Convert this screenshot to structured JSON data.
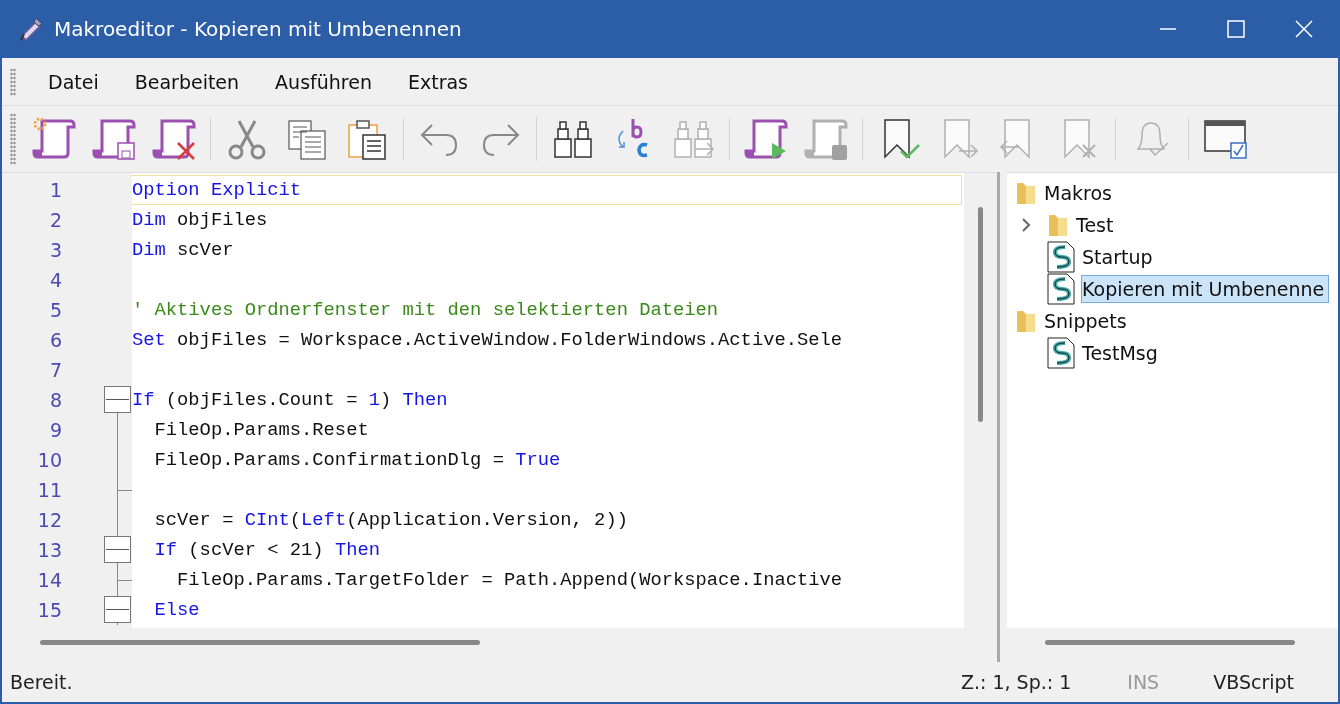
{
  "window": {
    "title": "Makroeditor - Kopieren mit Umbenennen"
  },
  "menu": [
    "Datei",
    "Bearbeiten",
    "Ausführen",
    "Extras"
  ],
  "toolbar": [
    [
      {
        "kind": "new",
        "disabled": false
      },
      {
        "kind": "save",
        "disabled": false
      },
      {
        "kind": "delete",
        "disabled": false
      }
    ],
    [
      {
        "kind": "cut",
        "disabled": false
      },
      {
        "kind": "copy",
        "disabled": false
      },
      {
        "kind": "paste",
        "disabled": false
      }
    ],
    [
      {
        "kind": "undo",
        "disabled": false
      },
      {
        "kind": "redo",
        "disabled": false
      }
    ],
    [
      {
        "kind": "find",
        "disabled": false
      },
      {
        "kind": "replace",
        "disabled": false
      },
      {
        "kind": "find-next",
        "disabled": true
      }
    ],
    [
      {
        "kind": "run",
        "disabled": false
      },
      {
        "kind": "stop",
        "disabled": true
      }
    ],
    [
      {
        "kind": "bookmark-set",
        "disabled": false
      },
      {
        "kind": "bookmark-next",
        "disabled": true
      },
      {
        "kind": "bookmark-prev",
        "disabled": true
      },
      {
        "kind": "bookmark-clear",
        "disabled": true
      }
    ],
    [
      {
        "kind": "notify",
        "disabled": true
      }
    ],
    [
      {
        "kind": "panel",
        "disabled": false
      }
    ]
  ],
  "editor": {
    "lines": [
      {
        "number": "1",
        "kind": "plain",
        "tokens": [
          {
            "kind": "keyword",
            "text": "Option Explicit"
          }
        ]
      },
      {
        "number": "2",
        "kind": "plain",
        "tokens": [
          {
            "kind": "keyword",
            "text": "Dim"
          },
          {
            "kind": "plain",
            "text": " objFiles"
          }
        ]
      },
      {
        "number": "3",
        "kind": "plain",
        "tokens": [
          {
            "kind": "keyword",
            "text": "Dim"
          },
          {
            "kind": "plain",
            "text": " scVer"
          }
        ]
      },
      {
        "number": "4",
        "kind": "plain"
      },
      {
        "number": "5",
        "kind": "plain",
        "tokens": [
          {
            "kind": "comment",
            "text": "' Aktives Ordnerfenster mit den selektierten Dateien"
          }
        ]
      },
      {
        "number": "6",
        "kind": "plain",
        "tokens": [
          {
            "kind": "keyword",
            "text": "Set"
          },
          {
            "kind": "plain",
            "text": " objFiles = Workspace.ActiveWindow.FolderWindows.Active.Sele"
          }
        ]
      },
      {
        "number": "7",
        "kind": "plain"
      },
      {
        "number": "8",
        "kind": "fold-box",
        "tokens": [
          {
            "kind": "keyword",
            "text": "If"
          },
          {
            "kind": "plain",
            "text": " (objFiles.Count = "
          },
          {
            "kind": "number",
            "text": "1"
          },
          {
            "kind": "plain",
            "text": ") "
          },
          {
            "kind": "keyword",
            "text": "Then"
          }
        ],
        "children": [
          {
            "number": "9",
            "kind": "fold-line",
            "tokens": [
              {
                "kind": "plain",
                "text": "FileOp.Params.Reset"
              }
            ]
          },
          {
            "number": "10",
            "kind": "fold-line",
            "tokens": [
              {
                "kind": "plain",
                "text": "FileOp.Params.ConfirmationDlg = "
              },
              {
                "kind": "keyword",
                "text": "True"
              }
            ]
          },
          {
            "number": "11",
            "kind": "fold-tick"
          },
          {
            "number": "12",
            "kind": "fold-line",
            "tokens": [
              {
                "kind": "plain",
                "text": "scVer = "
              },
              {
                "kind": "keyword",
                "text": "CInt"
              },
              {
                "kind": "plain",
                "text": "("
              },
              {
                "kind": "keyword",
                "text": "Left"
              },
              {
                "kind": "plain",
                "text": "(Application.Version, 2))"
              }
            ]
          },
          {
            "number": "13",
            "kind": "fold-box",
            "tokens": [
              {
                "kind": "keyword",
                "text": "If"
              },
              {
                "kind": "plain",
                "text": " (scVer < 21) "
              },
              {
                "kind": "keyword",
                "text": "Then"
              }
            ],
            "children": [
              {
                "number": "14",
                "kind": "fold-tick",
                "tokens": [
                  {
                    "kind": "plain",
                    "text": "FileOp.Params.TargetFolder = Path.Append(Workspace.Inactive"
                  }
                ]
              }
            ]
          },
          {
            "number": "15",
            "kind": "fold-box",
            "tokens": [
              {
                "kind": "keyword",
                "text": "Else"
              }
            ]
          }
        ]
      }
    ]
  },
  "tree": [
    {
      "kind": "folder",
      "label": "Makros",
      "expanded": true,
      "selected": false,
      "children": [
        {
          "kind": "folder",
          "label": "Test",
          "expanded": false,
          "selected": false
        },
        {
          "kind": "script",
          "label": "Startup",
          "selected": false
        },
        {
          "kind": "script",
          "label": "Kopieren mit Umbenenne",
          "selected": true
        }
      ]
    },
    {
      "kind": "folder",
      "label": "Snippets",
      "expanded": true,
      "selected": false,
      "children": [
        {
          "kind": "script",
          "label": "TestMsg",
          "selected": false
        }
      ]
    }
  ],
  "status_bar": {
    "message": "Bereit.",
    "position": "Z.: 1, Sp.: 1",
    "mode": {
      "text": "INS",
      "active": false
    },
    "language": "VBScript"
  }
}
